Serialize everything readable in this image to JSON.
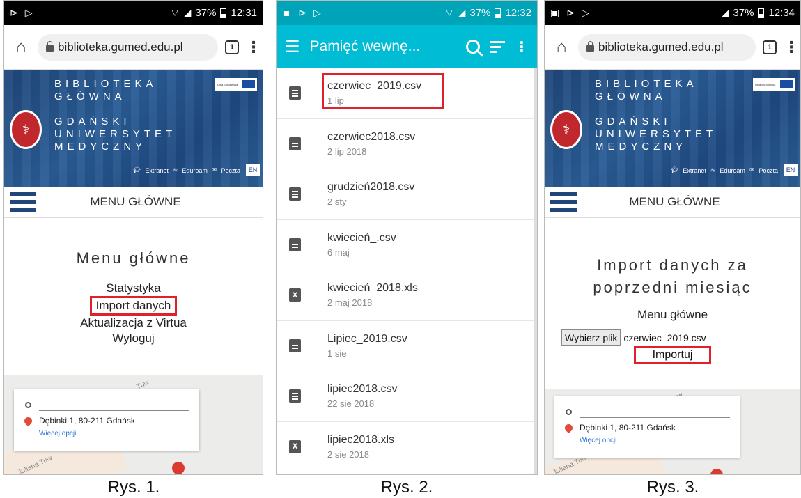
{
  "status1": {
    "battery": "37%",
    "time": "12:31"
  },
  "status2": {
    "battery": "37%",
    "time": "12:32"
  },
  "status3": {
    "battery": "37%",
    "time": "12:34"
  },
  "browser": {
    "url": "biblioteka.gumed.edu.pl",
    "tabs_count": "1"
  },
  "banner": {
    "line1": "BIBLIOTEKA",
    "line2": "GŁÓWNA",
    "line3": "GDAŃSKI",
    "line4": "UNIWERSYTET",
    "line5": "MEDYCZNY",
    "eu_label": "Unia Europejska",
    "links": [
      "Extranet",
      "Eduroam",
      "Poczta"
    ],
    "lang": "EN"
  },
  "menubar": {
    "title": "MENU GŁÓWNE"
  },
  "screen1": {
    "heading": "Menu główne",
    "items": [
      "Statystyka",
      "Import danych",
      "Aktualizacja z Virtua",
      "Wyloguj"
    ]
  },
  "map": {
    "address": "Dębinki 1, 80-211 Gdańsk",
    "more": "Więcej opcji",
    "road1": "Tuw",
    "road2": "Juliana Tuw"
  },
  "files_app": {
    "title": "Pamięć wewnę...",
    "files": [
      {
        "name": "czerwiec_2019.csv",
        "date": "1 lip",
        "type": "doc"
      },
      {
        "name": "czerwiec2018.csv",
        "date": "2 lip 2018",
        "type": "doc"
      },
      {
        "name": "grudzień2018.csv",
        "date": "2 sty",
        "type": "doc"
      },
      {
        "name": "kwiecień_.csv",
        "date": "6 maj",
        "type": "doc"
      },
      {
        "name": "kwiecień_2018.xls",
        "date": "2 maj 2018",
        "type": "xls"
      },
      {
        "name": "Lipiec_2019.csv",
        "date": "1 sie",
        "type": "doc"
      },
      {
        "name": "lipiec2018.csv",
        "date": "22 sie 2018",
        "type": "doc"
      },
      {
        "name": "lipiec2018.xls",
        "date": "2 sie 2018",
        "type": "xls"
      }
    ]
  },
  "screen3": {
    "heading_line1": "Import danych za",
    "heading_line2": "poprzedni miesiąc",
    "menu_link": "Menu główne",
    "choose_label": "Wybierz plik",
    "chosen_file": "czerwiec_2019.csv",
    "import_label": "Importuj"
  },
  "captions": [
    "Rys. 1.",
    "Rys. 2.",
    "Rys. 3."
  ],
  "colors": {
    "accent_red": "#e0202a",
    "brand_blue": "#21477a",
    "app_teal": "#00bcd4"
  }
}
